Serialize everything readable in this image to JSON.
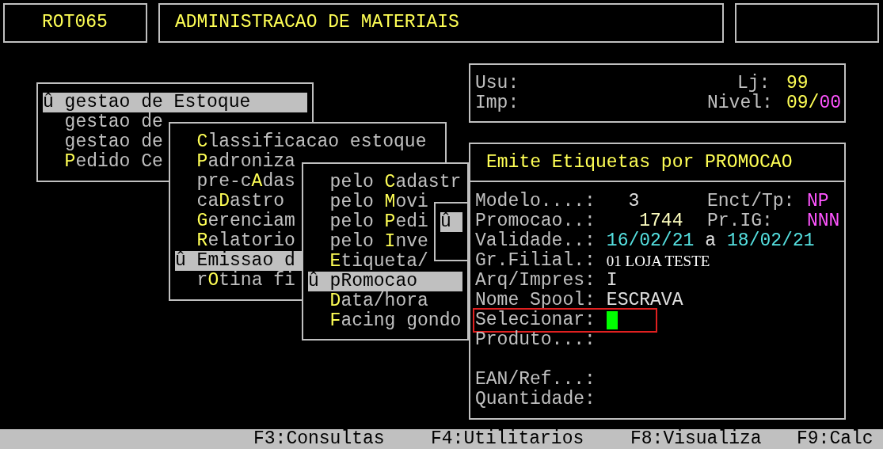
{
  "header": {
    "program": "ROT065",
    "title": "ADMINISTRACAO DE MATERIAIS"
  },
  "menus": [
    {
      "items": [
        {
          "marker": "û",
          "before": "gestao de Estoque",
          "selected": true
        },
        {
          "before": "gestao de",
          "selected": false
        },
        {
          "before": "gestao de",
          "selected": false
        },
        {
          "hotkey": "P",
          "after": "edido Ce",
          "selected": false
        }
      ]
    },
    {
      "items": [
        {
          "hotkey": "C",
          "after": "lassificacao estoque",
          "selected": false
        },
        {
          "hotkey": "P",
          "after": "adroniza",
          "selected": false
        },
        {
          "before": "pre-c",
          "hotkey": "A",
          "after": "das",
          "selected": false
        },
        {
          "before": "ca",
          "hotkey": "D",
          "after": "astro",
          "selected": false
        },
        {
          "hotkey": "G",
          "after": "erenciam",
          "selected": false
        },
        {
          "hotkey": "R",
          "after": "elatorio",
          "selected": false
        },
        {
          "marker": "û",
          "before": "Emissao d",
          "selected": true
        },
        {
          "before": "r",
          "hotkey": "O",
          "after": "tina fi",
          "selected": false
        }
      ]
    },
    {
      "items": [
        {
          "before": "pelo ",
          "hotkey": "C",
          "after": "adastr",
          "selected": false
        },
        {
          "before": "pelo ",
          "hotkey": "M",
          "after": "ovi",
          "selected": false
        },
        {
          "before": "pelo ",
          "hotkey": "P",
          "after": "edi",
          "selected": false
        },
        {
          "before": "pelo ",
          "hotkey": "I",
          "after": "nve",
          "selected": false
        },
        {
          "hotkey": "E",
          "after": "tiqueta/",
          "selected": false
        },
        {
          "marker": "û",
          "before": "pRomocao",
          "selected": true
        },
        {
          "hotkey": "D",
          "after": "ata/hora",
          "selected": false
        },
        {
          "hotkey": "F",
          "after": "acing gondo",
          "selected": false
        }
      ]
    },
    {
      "items": [
        {
          "marker": "û",
          "selected": true
        }
      ]
    }
  ],
  "session": {
    "user_label": "Usu:",
    "printer_label": "Imp:",
    "store_label": "Lj:",
    "store": "99",
    "level_label": "Nivel:",
    "level_parts": [
      {
        "text": "09/",
        "color": "#ffff55"
      },
      {
        "text": "00",
        "color": "#ff55ff"
      }
    ]
  },
  "form": {
    "title": "Emite Etiquetas por PROMOCAO",
    "fields": [
      {
        "label": "Modelo....:",
        "values": [
          {
            "text": "  3",
            "color": "#e0e0e0"
          }
        ],
        "extra_label": "Enct/Tp:",
        "extra_value": {
          "text": "NP",
          "color": "#ff55ff"
        }
      },
      {
        "label": "Promocao..:",
        "values": [
          {
            "text": "   1744",
            "color": "#ffffc0"
          }
        ],
        "extra_label": "Pr.IG:",
        "extra_value": {
          "text": "NNN",
          "color": "#ff55ff"
        }
      },
      {
        "label": "Validade..:",
        "values": [
          {
            "text": "16/02/21",
            "color": "#55e0e0"
          },
          {
            "text": "a",
            "color": "#e0e0e0"
          },
          {
            "text": "18/02/21",
            "color": "#55e0e0"
          }
        ]
      },
      {
        "label": "Gr.Filial.:",
        "values": [
          {
            "text": "01 LOJA TESTE",
            "color": "#ffffff",
            "kind": "serif"
          }
        ]
      },
      {
        "label": "Arq/Impres:",
        "values": [
          {
            "text": "I",
            "color": "#e0e0e0"
          }
        ]
      },
      {
        "label": "Nome Spool:",
        "values": [
          {
            "text": "ESCRAVA",
            "color": "#e0e0e0"
          }
        ]
      },
      {
        "label": "Selecionar:",
        "focused": true
      },
      {
        "label": "Produto...:",
        "gap_after": true
      },
      {
        "label": "EAN/Ref...:"
      },
      {
        "label": "Quantidade:"
      }
    ]
  },
  "status_bar": [
    "F3:Consultas",
    "F4:Utilitarios",
    "F8:Visualiza",
    "F9:Calc"
  ]
}
